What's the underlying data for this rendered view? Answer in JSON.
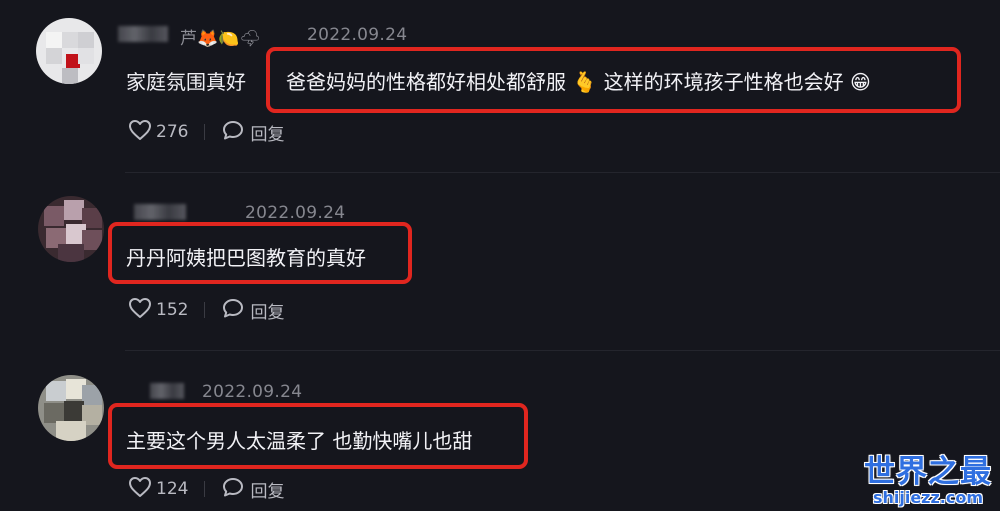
{
  "comments": [
    {
      "name_suffix": "芦🦊🍋🌩",
      "date": "2022.09.24",
      "text_prefix": "家庭氛围真好",
      "highlighted_text": "爸爸妈妈的性格都好相处都舒服 🫰 这样的环境孩子性格也会好 😁",
      "likes": "276",
      "reply_label": "回复"
    },
    {
      "name_suffix": "",
      "date": "2022.09.24",
      "text_prefix": "",
      "highlighted_text": "丹丹阿姨把巴图教育的真好",
      "likes": "152",
      "reply_label": "回复"
    },
    {
      "name_suffix": "",
      "date": "2022.09.24",
      "text_prefix": "",
      "highlighted_text": "主要这个男人太温柔了 也勤快嘴儿也甜",
      "likes": "124",
      "reply_label": "回复"
    }
  ],
  "watermark": {
    "title": "世界之最",
    "url": "shijiezz.com"
  },
  "colors": {
    "background": "#15161d",
    "highlight_border": "#e0261f",
    "watermark": "#2f6fe0"
  }
}
